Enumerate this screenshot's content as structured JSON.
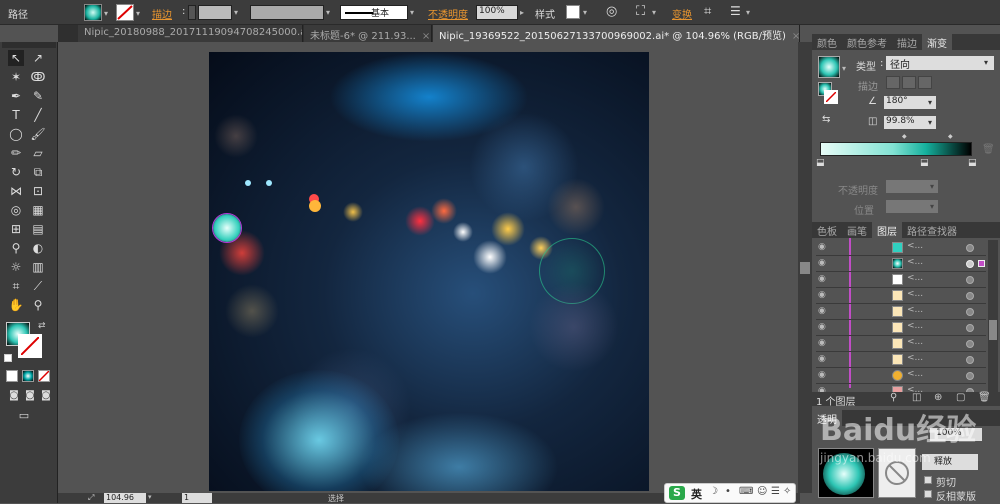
{
  "control_bar": {
    "object_type": "路径",
    "stroke_label": "描边",
    "stroke_profile": "基本",
    "opacity_label": "不透明度",
    "opacity_value": "100%",
    "style_label": "样式",
    "transform_label": "变换"
  },
  "tabs": [
    {
      "label": "Nipic_20180988_20171119094708245000.ai*",
      "close": "×"
    },
    {
      "label": "未标题-6* @ 211.93...",
      "close": "×"
    },
    {
      "label": "Nipic_19369522_20150627133700969002.ai* @ 104.96% (RGB/预览)",
      "close": "×"
    }
  ],
  "status": {
    "zoom": "104.96",
    "page": "1",
    "selection_label": "选择"
  },
  "gradient_panel": {
    "tabs": [
      "颜色",
      "颜色参考",
      "描边",
      "渐变"
    ],
    "type_label": "类型",
    "type_value": "径向",
    "stroke_label": "描边",
    "angle_value": "180°",
    "aspect_value": "99.8%",
    "opacity_label": "不透明度",
    "location_label": "位置"
  },
  "layers_panel": {
    "tabs": [
      "色板",
      "画笔",
      "图层",
      "路径查找器"
    ],
    "layer_count": "1 个图层",
    "rows": [
      {
        "name": "<..."
      },
      {
        "name": "<..."
      },
      {
        "name": "<..."
      },
      {
        "name": "<..."
      },
      {
        "name": "<..."
      },
      {
        "name": "<..."
      },
      {
        "name": "<..."
      },
      {
        "name": "<..."
      },
      {
        "name": "<..."
      },
      {
        "name": "<..."
      }
    ]
  },
  "transparency_panel": {
    "tab": "透明",
    "opacity_value": "100%",
    "btn_label": "释放",
    "clip_label": "剪切",
    "invert_label": "反相蒙版"
  },
  "ime": {
    "label": "英"
  },
  "watermark": {
    "text": "Baidu经验",
    "url": "jingyan.baidu.com"
  }
}
